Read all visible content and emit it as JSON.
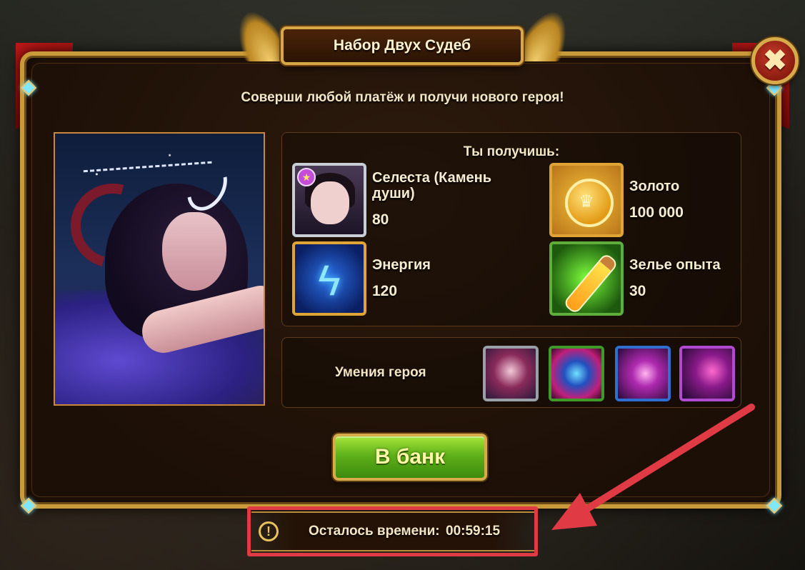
{
  "dialog": {
    "title": "Набор Двух Судеб",
    "subtitle": "Соверши любой платёж и получи нового героя!",
    "close_icon": "✖"
  },
  "rewards": {
    "heading": "Ты получишь:",
    "items": [
      {
        "name": "Селеста (Камень души)",
        "quantity": "80",
        "icon": "hero-soulstone-icon"
      },
      {
        "name": "Золото",
        "quantity": "100 000",
        "icon": "gold-coin-icon"
      },
      {
        "name": "Энергия",
        "quantity": "120",
        "icon": "energy-bolt-icon"
      },
      {
        "name": "Зелье опыта",
        "quantity": "30",
        "icon": "experience-potion-icon"
      }
    ]
  },
  "skills": {
    "label": "Умения героя",
    "items": [
      {
        "icon": "skill-1-icon",
        "border": "#9aa0a8"
      },
      {
        "icon": "skill-2-icon",
        "border": "#3f9a2a"
      },
      {
        "icon": "skill-3-icon",
        "border": "#2f6fd0"
      },
      {
        "icon": "skill-4-icon",
        "border": "#b04ad0"
      }
    ]
  },
  "bank_button": {
    "label": "В банк"
  },
  "timer": {
    "icon": "!",
    "label": "Осталось времени:",
    "value": "00:59:15"
  },
  "colors": {
    "frame_gold": "#c99a3a",
    "highlight_red": "#e03a45",
    "button_green": "#5fb11a"
  }
}
